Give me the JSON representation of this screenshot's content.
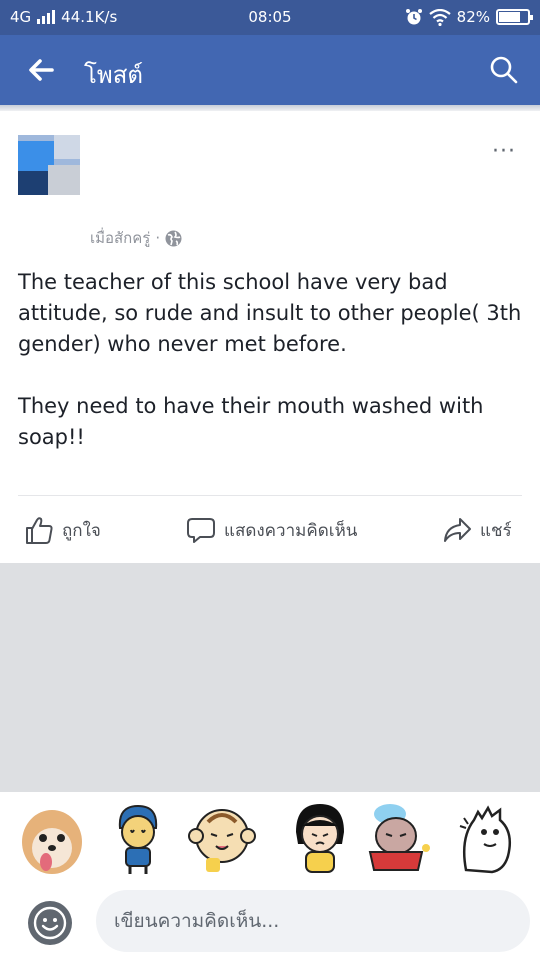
{
  "status_bar": {
    "network": "4G",
    "speed": "44.1K/s",
    "time": "08:05",
    "battery": "82%",
    "battery_level": 0.82
  },
  "app_bar": {
    "title": "โพสต์",
    "back_icon": "arrow-left-icon",
    "search_icon": "search-icon"
  },
  "post": {
    "author_name": "",
    "meta": "เมื่อสักครู่",
    "meta_separator": "·",
    "privacy_icon": "globe-icon",
    "more_icon": "more-icon",
    "more_label": "···",
    "body": [
      "The teacher of this school have very bad attitude, so rude and insult to other people( 3th gender) who never met before.",
      "They need to have their mouth washed with soap!!"
    ]
  },
  "actions": {
    "like": "ถูกใจ",
    "comment": "แสดงความคิดเห็น",
    "share": "แชร์"
  },
  "stickers": [
    "pomeranian-dog-sticker",
    "blue-haired-boy-sticker",
    "monkey-sticker",
    "girl-sticker",
    "dog-in-bath-sticker",
    "dinosaur-sticker"
  ],
  "composer": {
    "placeholder": "เขียนความคิดเห็น...",
    "value": "",
    "emoji_icon": "smiley-icon"
  },
  "colors": {
    "brand_dark": "#3b5998",
    "brand": "#4267b2",
    "page_bg": "#dddfe2"
  }
}
